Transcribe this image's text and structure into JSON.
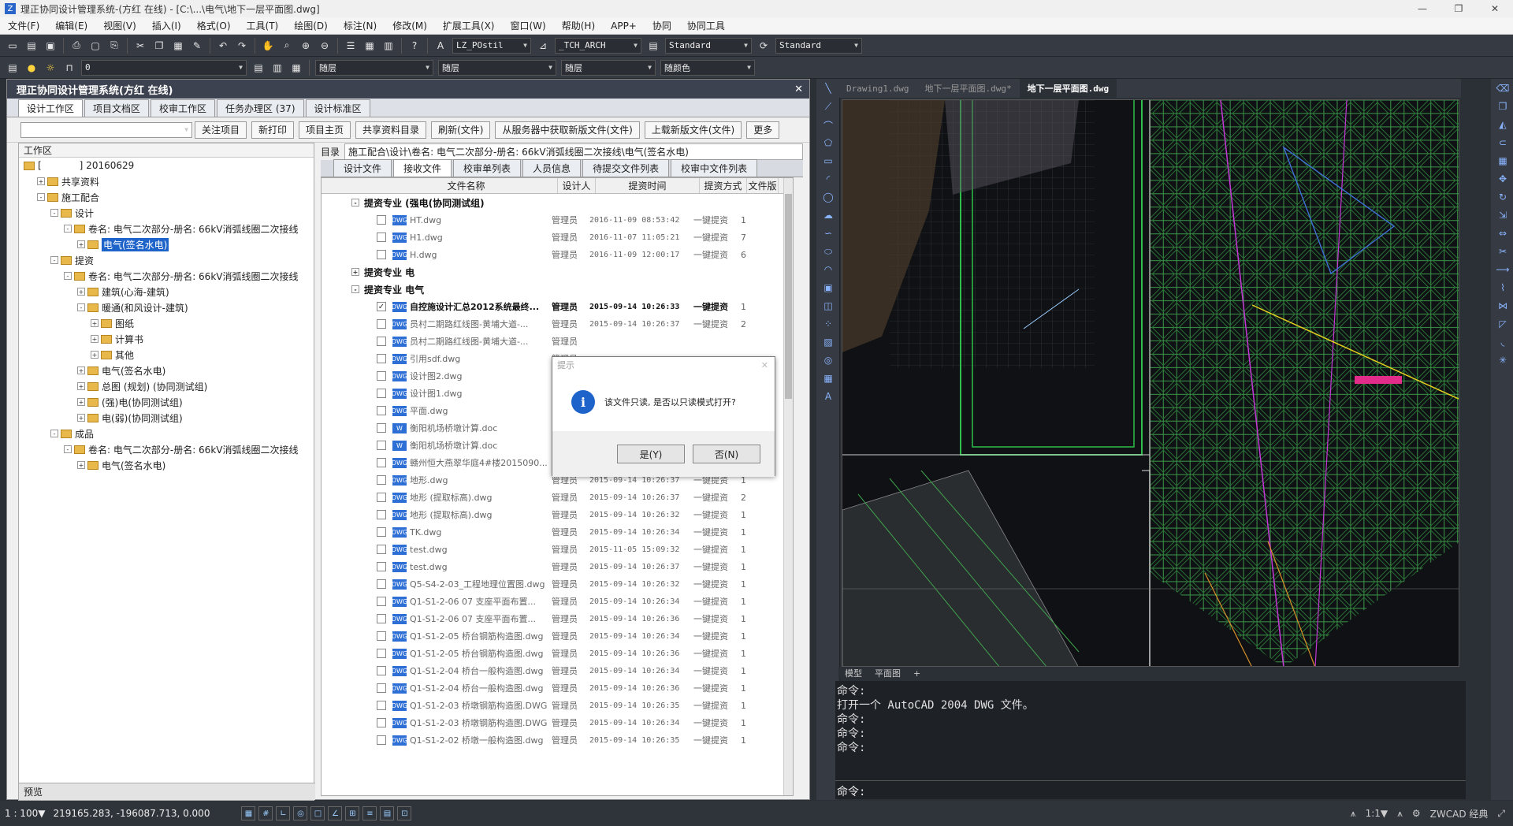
{
  "window": {
    "title": "理正协同设计管理系统-(方红 在线) - [C:\\...\\电气\\地下一层平面图.dwg]",
    "min": "—",
    "max": "❐",
    "close": "✕"
  },
  "menu": [
    "文件(F)",
    "编辑(E)",
    "视图(V)",
    "插入(I)",
    "格式(O)",
    "工具(T)",
    "绘图(D)",
    "标注(N)",
    "修改(M)",
    "扩展工具(X)",
    "窗口(W)",
    "帮助(H)",
    "APP+",
    "协同",
    "协同工具"
  ],
  "toolbar": {
    "textstyle": "LZ_POstil",
    "archstyle": "_TCH_ARCH",
    "dimstyle": "Standard",
    "tablestyle": "Standard",
    "layer": "0",
    "color": "随层",
    "linetype": "随层",
    "lineweight": "随层",
    "plotstyle": "随颜色"
  },
  "panel": {
    "title": "理正协同设计管理系统(方红 在线)",
    "close": "✕",
    "tabs": [
      "设计工作区",
      "项目文档区",
      "校审工作区",
      "任务办理区 (37)",
      "设计标准区"
    ],
    "buttons": [
      "关注项目",
      "新打印",
      "项目主页",
      "共享资料目录",
      "刷新(文件)",
      "从服务器中获取新版文件(文件)",
      "上载新版文件(文件)",
      "更多"
    ],
    "worklabel": "工作区",
    "preview": "预览",
    "tree": [
      {
        "t": "[        ] 20160629",
        "lvl": 0,
        "exp": "",
        "type": "root"
      },
      {
        "t": "共享资料",
        "lvl": 1,
        "exp": "+",
        "type": "fold"
      },
      {
        "t": "施工配合",
        "lvl": 1,
        "exp": "-",
        "type": "fold"
      },
      {
        "t": "设计",
        "lvl": 2,
        "exp": "-",
        "type": "fold"
      },
      {
        "t": "卷名: 电气二次部分-册名: 66kV消弧线圈二次接线",
        "lvl": 3,
        "exp": "-",
        "type": "fold"
      },
      {
        "t": "电气(签名水电)",
        "lvl": 4,
        "exp": "+",
        "type": "sel"
      },
      {
        "t": "提资",
        "lvl": 2,
        "exp": "-",
        "type": "fold"
      },
      {
        "t": "卷名: 电气二次部分-册名: 66kV消弧线圈二次接线",
        "lvl": 3,
        "exp": "-",
        "type": "fold"
      },
      {
        "t": "建筑(心海-建筑)",
        "lvl": 4,
        "exp": "+",
        "type": "fold"
      },
      {
        "t": "暖通(和风设计-建筑)",
        "lvl": 4,
        "exp": "-",
        "type": "fold"
      },
      {
        "t": "图纸",
        "lvl": 5,
        "exp": "+",
        "type": "fold"
      },
      {
        "t": "计算书",
        "lvl": 5,
        "exp": "+",
        "type": "fold"
      },
      {
        "t": "其他",
        "lvl": 5,
        "exp": "+",
        "type": "fold"
      },
      {
        "t": "电气(签名水电)",
        "lvl": 4,
        "exp": "+",
        "type": "fold"
      },
      {
        "t": "总图 (规划) (协同测试组)",
        "lvl": 4,
        "exp": "+",
        "type": "fold"
      },
      {
        "t": "(强)电(协同测试组)",
        "lvl": 4,
        "exp": "+",
        "type": "fold"
      },
      {
        "t": "电(弱)(协同测试组)",
        "lvl": 4,
        "exp": "+",
        "type": "fold"
      },
      {
        "t": "成品",
        "lvl": 2,
        "exp": "-",
        "type": "fold"
      },
      {
        "t": "卷名: 电气二次部分-册名: 66kV消弧线圈二次接线",
        "lvl": 3,
        "exp": "-",
        "type": "fold"
      },
      {
        "t": "电气(签名水电)",
        "lvl": 4,
        "exp": "+",
        "type": "fold"
      }
    ]
  },
  "right": {
    "path_label": "目录",
    "path": "施工配合\\设计\\卷名: 电气二次部分-册名: 66kV消弧线圈二次接线\\电气(签名水电)",
    "tabs": [
      "设计文件",
      "接收文件",
      "校审单列表",
      "人员信息",
      "待提交文件列表",
      "校审中文件列表"
    ],
    "cols": [
      "文件名称",
      "设计人",
      "提资时间",
      "提资方式",
      "文件版"
    ],
    "groups": [
      {
        "title": "提资专业  (强电(协同测试组)",
        "exp": "-",
        "rows": [
          [
            "HT.dwg",
            "管理员",
            "2016-11-09 08:53:42",
            "一键提资",
            "1",
            false
          ],
          [
            "H1.dwg",
            "管理员",
            "2016-11-07 11:05:21",
            "一键提资",
            "7",
            false
          ],
          [
            "H.dwg",
            "管理员",
            "2016-11-09 12:00:17",
            "一键提资",
            "6",
            false
          ]
        ]
      },
      {
        "title": "提资专业  电",
        "exp": "+",
        "rows": []
      },
      {
        "title": "提资专业  电气",
        "exp": "-",
        "rows": [
          [
            "自控施设计汇总2012系统最终...",
            "管理员",
            "2015-09-14 10:26:33",
            "一键提资",
            "1",
            true
          ],
          [
            "员村二期路红线图-黄埔大道-...",
            "管理员",
            "2015-09-14 10:26:37",
            "一键提资",
            "2",
            false
          ],
          [
            "员村二期路红线图-黄埔大道-...",
            "管理员",
            "",
            "",
            "",
            false
          ],
          [
            "引用sdf.dwg",
            "管理员",
            "",
            "",
            "",
            false
          ],
          [
            "设计图2.dwg",
            "管理员",
            "",
            "",
            "",
            false
          ],
          [
            "设计图1.dwg",
            "管理员",
            "",
            "",
            "",
            false
          ],
          [
            "平面.dwg",
            "管理员",
            "",
            "",
            "",
            false
          ],
          [
            "衡阳机场桥墩计算.doc",
            "管理员",
            "",
            "",
            "",
            false
          ],
          [
            "衡阳机场桥墩计算.doc",
            "管理员",
            "",
            "",
            "",
            false
          ],
          [
            "赣州恒大燕翠华庭4#楼2015090...",
            "管理员",
            "",
            "",
            "",
            false
          ],
          [
            "地形.dwg",
            "管理员",
            "2015-09-14 10:26:37",
            "一键提资",
            "1",
            false
          ],
          [
            "地形 (提取标高).dwg",
            "管理员",
            "2015-09-14 10:26:37",
            "一键提资",
            "2",
            false
          ],
          [
            "地形 (提取标高).dwg",
            "管理员",
            "2015-09-14 10:26:32",
            "一键提资",
            "1",
            false
          ],
          [
            "TK.dwg",
            "管理员",
            "2015-09-14 10:26:34",
            "一键提资",
            "1",
            false
          ],
          [
            "test.dwg",
            "管理员",
            "2015-11-05 15:09:32",
            "一键提资",
            "1",
            false
          ],
          [
            "test.dwg",
            "管理员",
            "2015-09-14 10:26:37",
            "一键提资",
            "1",
            false
          ],
          [
            "Q5-S4-2-03_工程地理位置图.dwg",
            "管理员",
            "2015-09-14 10:26:32",
            "一键提资",
            "1",
            false
          ],
          [
            "Q1-S1-2-06 07 支座平面布置...",
            "管理员",
            "2015-09-14 10:26:34",
            "一键提资",
            "1",
            false
          ],
          [
            "Q1-S1-2-06 07 支座平面布置...",
            "管理员",
            "2015-09-14 10:26:36",
            "一键提资",
            "1",
            false
          ],
          [
            "Q1-S1-2-05 桥台钢筋构造图.dwg",
            "管理员",
            "2015-09-14 10:26:34",
            "一键提资",
            "1",
            false
          ],
          [
            "Q1-S1-2-05 桥台钢筋构造图.dwg",
            "管理员",
            "2015-09-14 10:26:36",
            "一键提资",
            "1",
            false
          ],
          [
            "Q1-S1-2-04 桥台一般构造图.dwg",
            "管理员",
            "2015-09-14 10:26:34",
            "一键提资",
            "1",
            false
          ],
          [
            "Q1-S1-2-04 桥台一般构造图.dwg",
            "管理员",
            "2015-09-14 10:26:36",
            "一键提资",
            "1",
            false
          ],
          [
            "Q1-S1-2-03 桥墩钢筋构造图.DWG",
            "管理员",
            "2015-09-14 10:26:35",
            "一键提资",
            "1",
            false
          ],
          [
            "Q1-S1-2-03 桥墩钢筋构造图.DWG",
            "管理员",
            "2015-09-14 10:26:34",
            "一键提资",
            "1",
            false
          ],
          [
            "Q1-S1-2-02 桥墩一般构造图.dwg",
            "管理员",
            "2015-09-14 10:26:35",
            "一键提资",
            "1",
            false
          ]
        ]
      }
    ]
  },
  "dialog": {
    "title": "提示",
    "message": "该文件只读, 是否以只读模式打开?",
    "yes": "是(Y)",
    "no": "否(N)",
    "close": "✕"
  },
  "cad": {
    "tabs": [
      "Drawing1.dwg",
      "地下一层平面图.dwg*",
      "地下一层平面图.dwg"
    ],
    "layout_tabs": [
      "模型",
      "平面图",
      "+"
    ],
    "commands": [
      "命令:",
      "打开一个 AutoCAD 2004 DWG 文件。",
      "命令:",
      "命令:",
      "命令:"
    ],
    "prompt": "命令:"
  },
  "status": {
    "scale": "1 : 100▼",
    "coords": "219165.283, -196087.713, 0.000",
    "right": [
      "1:1▼",
      "ZWCAD 经典"
    ]
  }
}
